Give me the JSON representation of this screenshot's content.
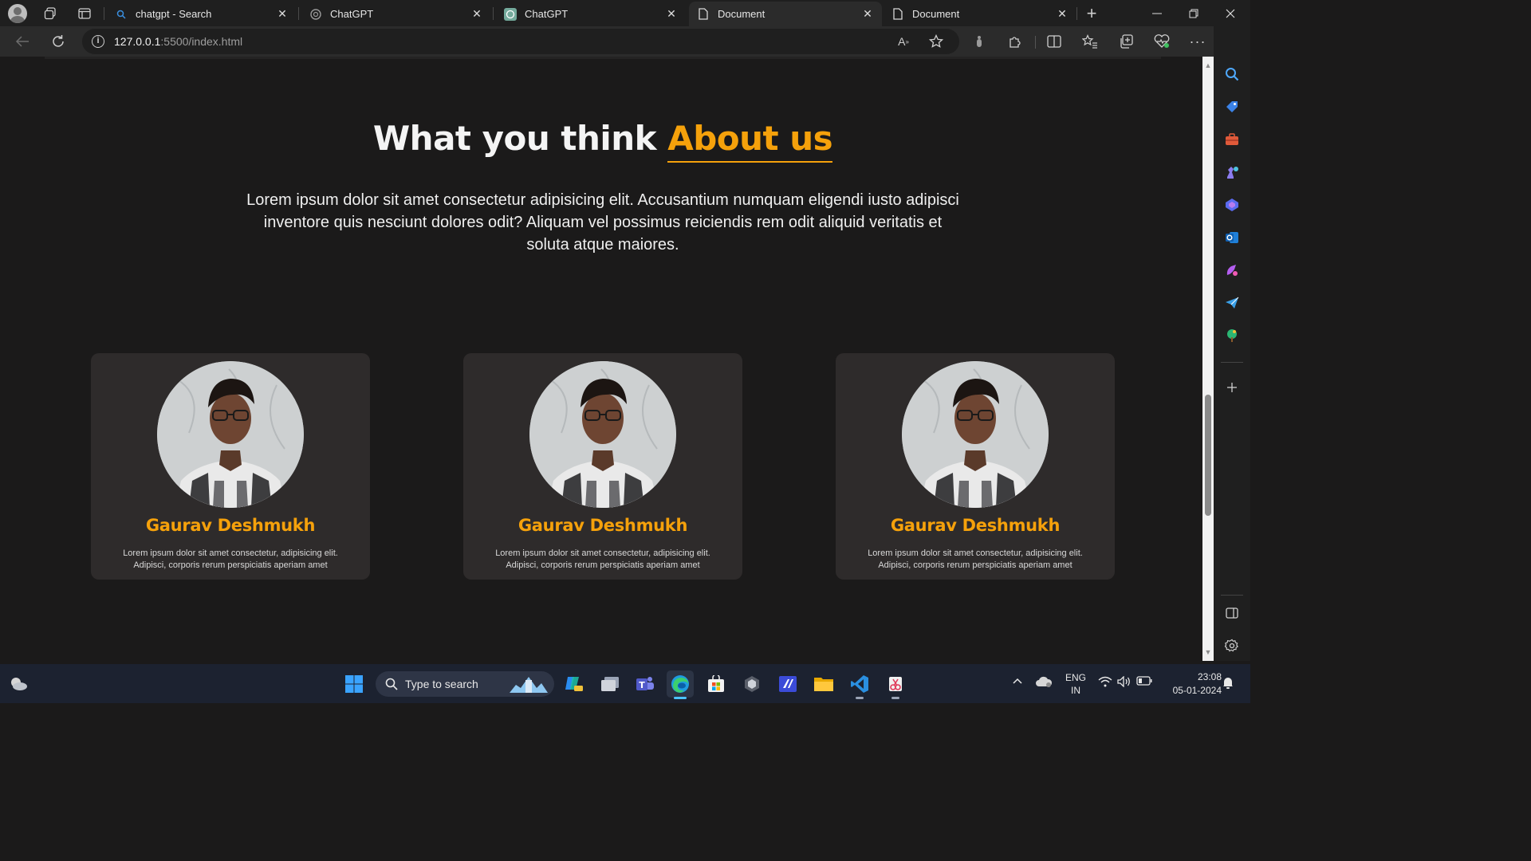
{
  "browser": {
    "tabs": [
      {
        "title": "chatgpt - Search",
        "favicon": "search-icon",
        "active": false
      },
      {
        "title": "ChatGPT",
        "favicon": "chatgpt-icon",
        "active": false
      },
      {
        "title": "ChatGPT",
        "favicon": "chatgpt-icon",
        "active": false
      },
      {
        "title": "Document",
        "favicon": "document-icon",
        "active": true
      },
      {
        "title": "Document",
        "favicon": "document-icon",
        "active": false
      }
    ],
    "close_glyph": "✕",
    "new_tab_glyph": "+",
    "url_host": "127.0.0.1",
    "url_path": ":5500/index.html"
  },
  "page": {
    "heading_main": "What you think ",
    "heading_accent": "About us",
    "lead": "Lorem ipsum dolor sit amet consectetur adipisicing elit. Accusantium numquam eligendi iusto adipisci inventore quis nesciunt dolores odit? Aliquam vel possimus reiciendis rem odit aliquid veritatis et soluta atque maiores.",
    "cards": [
      {
        "name": "Gaurav Deshmukh",
        "text": "Lorem ipsum dolor sit amet consectetur, adipisicing elit. Adipisci, corporis rerum perspiciatis aperiam amet"
      },
      {
        "name": "Gaurav Deshmukh",
        "text": "Lorem ipsum dolor sit amet consectetur, adipisicing elit. Adipisci, corporis rerum perspiciatis aperiam amet"
      },
      {
        "name": "Gaurav Deshmukh",
        "text": "Lorem ipsum dolor sit amet consectetur, adipisicing elit. Adipisci, corporis rerum perspiciatis aperiam amet"
      }
    ]
  },
  "taskbar": {
    "search_placeholder": "Type to search",
    "lang_top": "ENG",
    "lang_bottom": "IN",
    "time": "23:08",
    "date": "05-01-2024"
  },
  "colors": {
    "accent": "#f5a10b",
    "page_bg": "#1b1a1a",
    "card_bg": "#2e2b2b"
  }
}
